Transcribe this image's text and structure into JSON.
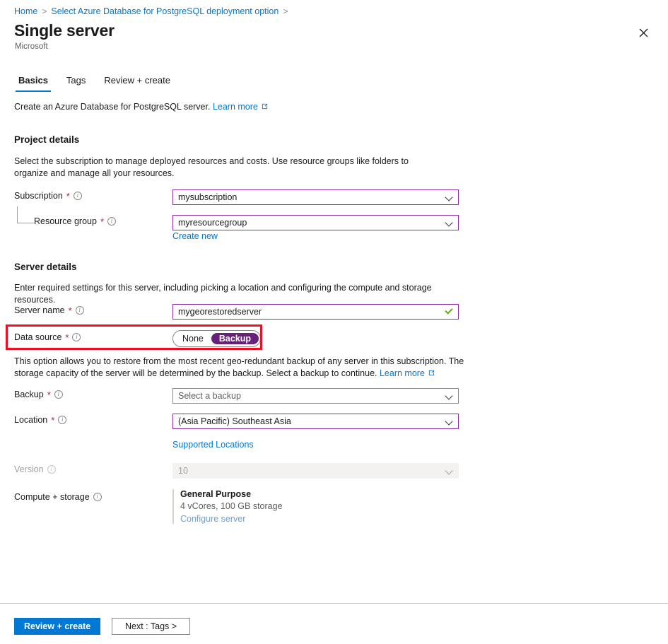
{
  "breadcrumb": {
    "items": [
      {
        "label": "Home",
        "sep": ">"
      },
      {
        "label": "Select Azure Database for PostgreSQL deployment option",
        "sep": ">"
      }
    ]
  },
  "header": {
    "title": "Single server",
    "publisher": "Microsoft",
    "close_icon": "close-icon"
  },
  "tabs": [
    {
      "label": "Basics",
      "active": true
    },
    {
      "label": "Tags",
      "active": false
    },
    {
      "label": "Review + create",
      "active": false
    }
  ],
  "intro": {
    "text": "Create an Azure Database for PostgreSQL server.",
    "link": "Learn more"
  },
  "project_details": {
    "heading": "Project details",
    "description": "Select the subscription to manage deployed resources and costs. Use resource groups like folders to organize and manage all your resources.",
    "subscription": {
      "label": "Subscription",
      "required": "*",
      "value": "mysubscription"
    },
    "resource_group": {
      "label": "Resource group",
      "required": "*",
      "value": "myresourcegroup",
      "create_new": "Create new"
    }
  },
  "server_details": {
    "heading": "Server details",
    "description": "Enter required settings for this server, including picking a location and configuring the compute and storage resources.",
    "server_name": {
      "label": "Server name",
      "required": "*",
      "value": "mygeorestoredserver"
    },
    "data_source": {
      "label": "Data source",
      "required": "*",
      "options": [
        "None",
        "Backup"
      ],
      "selected": "Backup"
    },
    "data_source_note": {
      "text": "This option allows you to restore from the most recent geo-redundant backup of any server in this subscription. The storage capacity of the server will be determined by the backup. Select a backup to continue.",
      "link": "Learn more"
    },
    "backup": {
      "label": "Backup",
      "required": "*",
      "placeholder": "Select a backup",
      "value": ""
    },
    "location": {
      "label": "Location",
      "required": "*",
      "value": "(Asia Pacific) Southeast Asia",
      "supported_link": "Supported Locations"
    },
    "version": {
      "label": "Version",
      "value": "10",
      "disabled": true
    },
    "compute_storage": {
      "label": "Compute + storage",
      "tier": "General Purpose",
      "spec": "4 vCores, 100 GB storage",
      "link": "Configure server"
    }
  },
  "footer": {
    "review_create": "Review + create",
    "next": "Next : Tags >"
  },
  "colors": {
    "accent_blue": "#0078d4",
    "focus_purple": "#8c2fa8",
    "toggle_purple": "#68217a",
    "required_red": "#a4262c",
    "valid_green": "#5db300",
    "annotation_red": "#e81123"
  }
}
